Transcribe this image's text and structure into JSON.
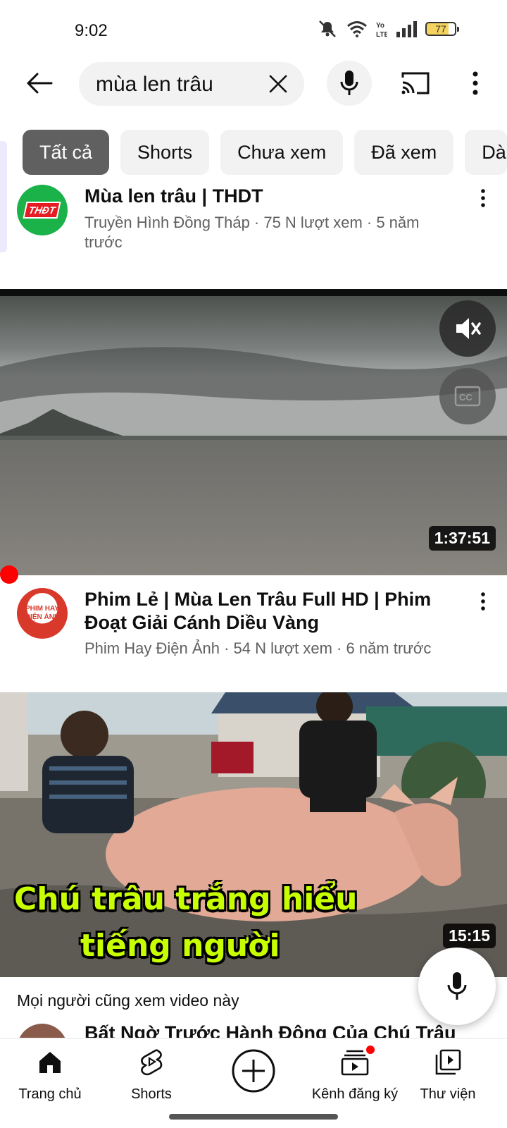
{
  "status_bar": {
    "time": "9:02",
    "battery": "77",
    "icons": [
      "mute-icon",
      "wifi-icon",
      "volte-icon",
      "signal-icon",
      "battery-icon"
    ]
  },
  "search": {
    "query": "mùa len trâu"
  },
  "chips": [
    "Tất cả",
    "Shorts",
    "Chưa xem",
    "Đã xem",
    "Dà"
  ],
  "results": [
    {
      "title": "Mùa len trâu | THDT",
      "avatar_text": "THĐT",
      "meta": "Truyền Hình Đồng Tháp · 75 N lượt xem · 5 năm trước"
    },
    {
      "title": "Phim Lẻ | Mùa Len Trâu Full HD | Phim Đoạt Giải Cánh Diều Vàng",
      "avatar_text": "PHIM HAY ĐIỆN ẢNH",
      "meta": "Phim Hay Điện Ảnh · 54 N lượt xem · 6 năm trước",
      "duration": "1:37:51"
    },
    {
      "caption_line1": "Chú trâu trắng hiểu",
      "caption_line2": "tiếng người",
      "duration": "15:15"
    }
  ],
  "related": {
    "label": "Mọi người cũng xem video này",
    "partial_title": "Bất Ngờ Trước Hành Động Của Chú Trâu"
  },
  "nav": {
    "home": "Trang chủ",
    "shorts": "Shorts",
    "subscriptions": "Kênh đăng ký",
    "library": "Thư viện"
  },
  "colors": {
    "accent_red": "#ff0000",
    "chip_active": "#606060",
    "chip_bg": "#f2f2f2",
    "thumb_caption": "#c8ff00"
  }
}
